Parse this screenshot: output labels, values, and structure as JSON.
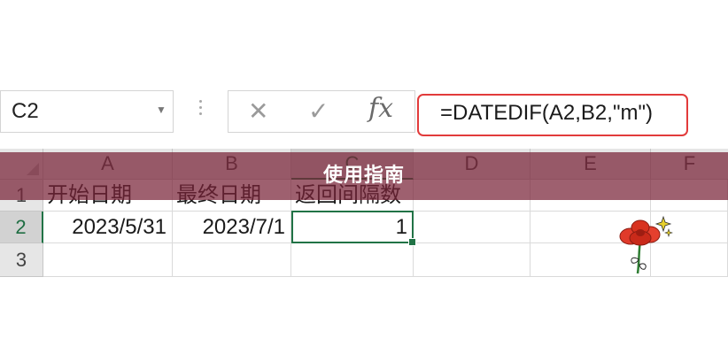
{
  "name_box": {
    "value": "C2"
  },
  "formula_bar": {
    "cancel_icon": "close-icon",
    "enter_icon": "check-icon",
    "fx_label": "fx",
    "formula": "=DATEDIF(A2,B2,\"m\")"
  },
  "columns": [
    "A",
    "B",
    "C",
    "D",
    "E",
    "F"
  ],
  "rows": [
    "1",
    "2",
    "3"
  ],
  "cells": {
    "A1": "开始日期",
    "B1": "最终日期",
    "C1": "返回间隔数",
    "A2": "2023/5/31",
    "B2": "2023/7/1",
    "C2": "1"
  },
  "selection": {
    "active_cell": "C2"
  },
  "overlay": {
    "title": "使用指南"
  },
  "colors": {
    "accent": "#217346",
    "highlight_border": "#e23b3b",
    "banner": "#782237"
  }
}
